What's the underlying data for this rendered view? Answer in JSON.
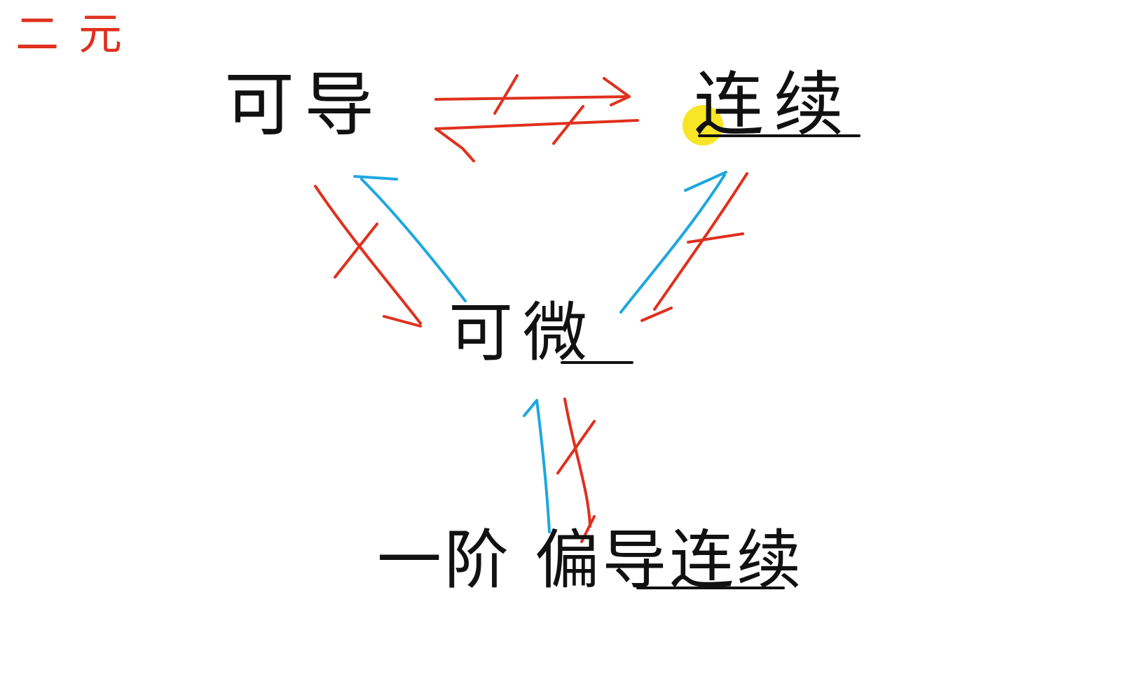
{
  "title": "二元",
  "nodes": {
    "top_left": "可导",
    "top_right": "连续",
    "center": "可微",
    "bottom": "一阶 偏导连续"
  },
  "colors": {
    "ink": "#111111",
    "title": "#e0301e",
    "not_implies": "#e0301e",
    "implies": "#1ea7e0",
    "cursor": "#f7e000"
  },
  "relations": [
    {
      "from": "可导",
      "to": "连续",
      "implies": false
    },
    {
      "from": "连续",
      "to": "可导",
      "implies": false
    },
    {
      "from": "可导",
      "to": "可微",
      "implies": false
    },
    {
      "from": "可微",
      "to": "可导",
      "implies": true
    },
    {
      "from": "可微",
      "to": "连续",
      "implies": true
    },
    {
      "from": "连续",
      "to": "可微",
      "implies": false
    },
    {
      "from": "一阶 偏导连续",
      "to": "可微",
      "implies": true
    },
    {
      "from": "可微",
      "to": "一阶 偏导连续",
      "implies": false
    }
  ]
}
